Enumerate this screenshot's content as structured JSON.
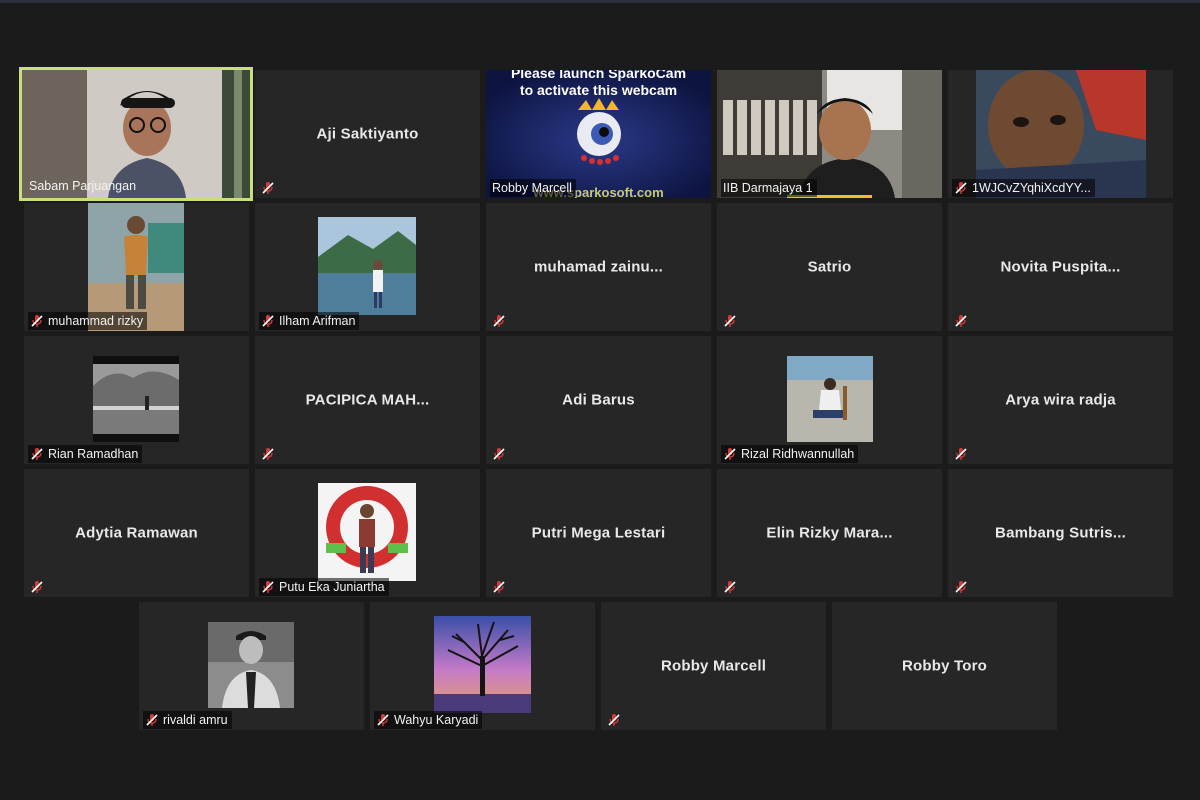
{
  "participants": [
    {
      "name": "Sabam Parjuangan",
      "active": true
    },
    {
      "name": "Aji Saktiyanto"
    },
    {
      "name": "Robby Marcell",
      "webcam_text": [
        "Please launch SparkoCam",
        "to activate this webcam"
      ],
      "webcam_url": "www.sparkosoft.com"
    },
    {
      "name": "IIB Darmajaya 1"
    },
    {
      "name": "1WJCvZYqhiXcdYY..."
    },
    {
      "name": "muhammad rizky"
    },
    {
      "name": "Ilham Arifman"
    },
    {
      "name": "muhamad  zainu..."
    },
    {
      "name": "Satrio"
    },
    {
      "name": "Novita  Puspita..."
    },
    {
      "name": "Rian Ramadhan"
    },
    {
      "name": "PACIPICA  MAH..."
    },
    {
      "name": "Adi Barus"
    },
    {
      "name": "Rizal Ridhwannullah"
    },
    {
      "name": "Arya wira radja"
    },
    {
      "name": "Adytia Ramawan"
    },
    {
      "name": "Putu Eka Juniartha"
    },
    {
      "name": "Putri Mega Lestari"
    },
    {
      "name": "Elin  Rizky  Mara..."
    },
    {
      "name": "Bambang  Sutris..."
    },
    {
      "name": "rivaldi amru"
    },
    {
      "name": "Wahyu Karyadi"
    },
    {
      "name": "Robby Marcell"
    },
    {
      "name": "Robby Toro"
    }
  ],
  "icons": {
    "mute": "microphone-muted-icon"
  },
  "colors": {
    "active_border": "#c9df78",
    "mute_red": "#d33a3a",
    "tile_bg": "#262626"
  }
}
